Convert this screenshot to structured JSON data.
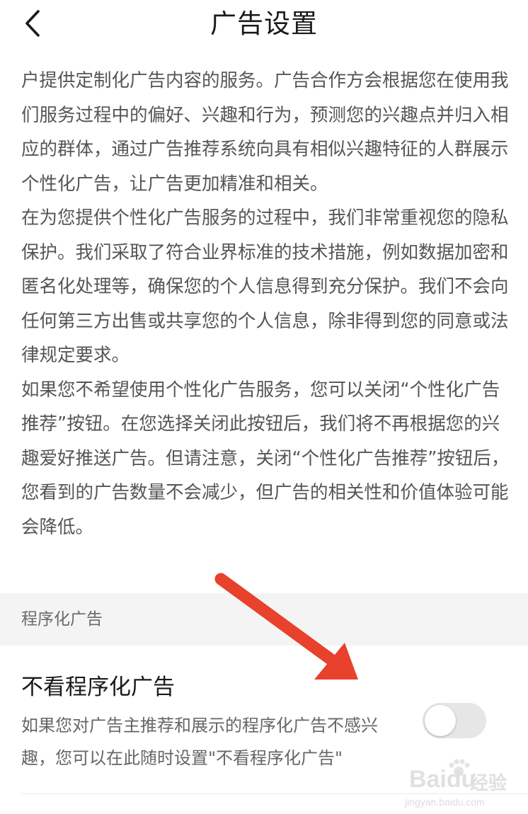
{
  "header": {
    "title": "广告设置",
    "back_icon": "chevron-left-icon"
  },
  "body": {
    "paragraphs": [
      "户提供定制化广告内容的服务。广告合作方会根据您在使用我们服务过程中的偏好、兴趣和行为，预测您的兴趣点并归入相应的群体，通过广告推荐系统向具有相似兴趣特征的人群展示个性化广告，让广告更加精准和相关。",
      "在为您提供个性化广告服务的过程中，我们非常重视您的隐私保护。我们采取了符合业界标准的技术措施，例如数据加密和匿名化处理等，确保您的个人信息得到充分保护。我们不会向任何第三方出售或共享您的个人信息，除非得到您的同意或法律规定要求。",
      "如果您不希望使用个性化广告服务，您可以关闭“个性化广告推荐”按钮。在您选择关闭此按钮后，我们将不再根据您的兴趣爱好推送广告。但请注意，关闭“个性化广告推荐”按钮后，您看到的广告数量不会减少，但广告的相关性和价值体验可能会降低。"
    ]
  },
  "section": {
    "label": "程序化广告"
  },
  "setting": {
    "title": "不看程序化广告",
    "description": "如果您对广告主推荐和展示的程序化广告不感兴趣，您可以在此随时设置\"不看程序化广告\"",
    "toggle_on": false
  },
  "colors": {
    "arrow": "#e8412c",
    "toggle_off": "#e6e6e6",
    "section_bg": "#f4f4f4"
  },
  "watermark": {
    "brand": "Baidu",
    "brand_cn": "经验",
    "url": "jingyan.baidu.com"
  }
}
